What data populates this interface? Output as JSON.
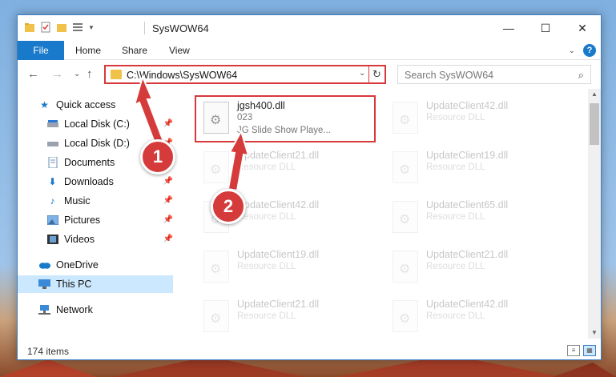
{
  "window": {
    "title": "SysWOW64",
    "controls": {
      "minimize": "—",
      "maximize": "☐",
      "close": "✕"
    }
  },
  "ribbon": {
    "tabs": [
      "File",
      "Home",
      "Share",
      "View"
    ],
    "help": "?"
  },
  "nav": {
    "address": "C:\\Windows\\SysWOW64",
    "search_placeholder": "Search SysWOW64"
  },
  "sidebar": {
    "items": [
      {
        "label": "Quick access",
        "icon": "star-icon"
      },
      {
        "label": "Local Disk (C:)",
        "icon": "drive-icon",
        "pinned": true
      },
      {
        "label": "Local Disk (D:)",
        "icon": "drive-icon",
        "pinned": true
      },
      {
        "label": "Documents",
        "icon": "documents-icon",
        "pinned": true
      },
      {
        "label": "Downloads",
        "icon": "download-icon",
        "pinned": true
      },
      {
        "label": "Music",
        "icon": "music-icon",
        "pinned": true
      },
      {
        "label": "Pictures",
        "icon": "pictures-icon",
        "pinned": true
      },
      {
        "label": "Videos",
        "icon": "videos-icon",
        "pinned": true
      },
      {
        "label": "OneDrive",
        "icon": "cloud-icon"
      },
      {
        "label": "This PC",
        "icon": "computer-icon",
        "selected": true
      },
      {
        "label": "Network",
        "icon": "network-icon"
      }
    ]
  },
  "files": {
    "highlighted": {
      "name": "jgsh400.dll",
      "line2": "023",
      "line3": "JG Slide Show Playe..."
    },
    "others": [
      {
        "name": "UpdateClient42.dll",
        "type": "Resource DLL"
      },
      {
        "name": "UpdateClient21.dll",
        "type": "Resource DLL"
      },
      {
        "name": "UpdateClient19.dll",
        "type": "Resource DLL"
      },
      {
        "name": "UpdateClient42.dll",
        "type": "Resource DLL"
      },
      {
        "name": "UpdateClient65.dll",
        "type": "Resource DLL"
      },
      {
        "name": "UpdateClient19.dll",
        "type": "Resource DLL"
      },
      {
        "name": "UpdateClient21.dll",
        "type": "Resource DLL"
      },
      {
        "name": "UpdateClient21.dll",
        "type": "Resource DLL"
      },
      {
        "name": "UpdateClient42.dll",
        "type": "Resource DLL"
      }
    ]
  },
  "status": {
    "count": "174 items"
  },
  "callouts": [
    "1",
    "2"
  ],
  "colors": {
    "accent": "#1979ca",
    "callout": "#d63b3b",
    "selection": "#cce8ff"
  }
}
